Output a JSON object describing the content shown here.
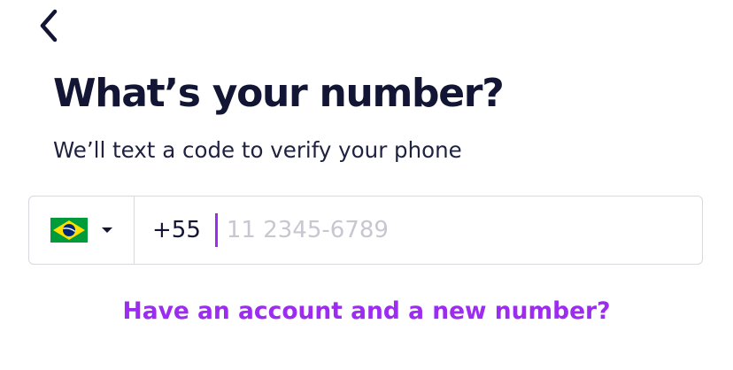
{
  "header": {
    "back_icon": "chevron-left-icon"
  },
  "title": "What’s your number?",
  "subtitle": "We’ll text a code to verify your phone",
  "phone": {
    "country_flag": "brazil-flag-icon",
    "dropdown_icon": "caret-down-icon",
    "dial_code": "+55",
    "value": "",
    "placeholder": "11 2345-6789"
  },
  "link": {
    "account_label": "Have an account and a new number?"
  },
  "colors": {
    "text": "#121533",
    "accent": "#9b2cf0",
    "border": "#d8d8e0",
    "placeholder": "#c7c7d2",
    "flag_green": "#009c3b",
    "flag_yellow": "#ffdf00",
    "flag_blue": "#002776"
  }
}
